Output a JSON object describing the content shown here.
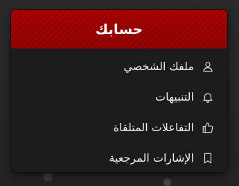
{
  "menu": {
    "title": "حسابك",
    "items": [
      {
        "label": "ملفك الشخصي",
        "icon": "user-icon"
      },
      {
        "label": "التنبيهات",
        "icon": "bell-icon"
      },
      {
        "label": "التفاعلات المتلقاة",
        "icon": "thumbs-up-icon"
      },
      {
        "label": "الإشارات المرجعية",
        "icon": "bookmark-icon"
      }
    ]
  },
  "colors": {
    "header_bg": "#8b0000",
    "menu_bg": "#1b1b1b",
    "text": "#f0f0f0"
  }
}
